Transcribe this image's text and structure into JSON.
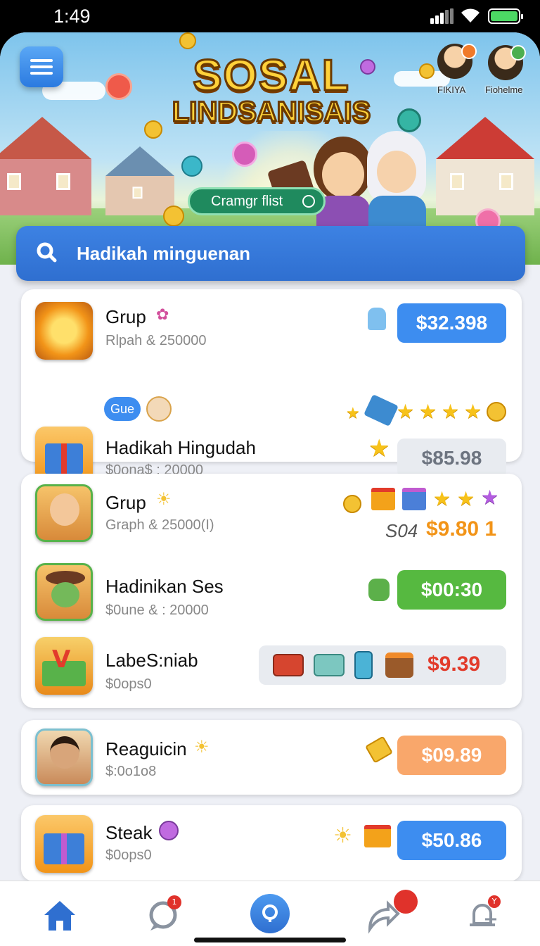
{
  "status_bar": {
    "time": "1:49"
  },
  "banner": {
    "logo_line1": "SOSAL",
    "logo_line2": "LINDSANISAIS",
    "cta_label": "Cramgr flist",
    "avatars": [
      {
        "name": "FIKIYA",
        "icon": "person-avatar"
      },
      {
        "name": "Fiohelme",
        "icon": "person-avatar"
      }
    ]
  },
  "search": {
    "placeholder": "Hadikah minguenan"
  },
  "cards": [
    {
      "rows": [
        {
          "title": "Grup",
          "subtitle": "Rlpah & 250000",
          "price": "$32.398",
          "price_color": "#3d8df0",
          "thumb_icon": "sun-icon"
        },
        {
          "tag": "Gue"
        },
        {
          "title": "Hadikah Hingudah",
          "subtitle": "$0ona$ : 20000",
          "price": "$85.98",
          "price_color": "#e8ebf0",
          "thumb_icon": "gift-icon"
        }
      ]
    },
    {
      "rows": [
        {
          "title": "Grup",
          "subtitle": "Graph & 25000(I)",
          "price_prefix": "S04",
          "price": "$9.80 1",
          "price_color": "#f29418",
          "thumb_icon": "person-icon"
        },
        {
          "title": "Hadinikan Ses",
          "subtitle": "$0une & : 20000",
          "price": "$00:30",
          "price_color": "#56b940",
          "thumb_icon": "hat-person-icon"
        },
        {
          "title": "LabeS:niab",
          "subtitle": "$0ops0",
          "price": "$9.39",
          "price_color": "#e23b2b",
          "thumb_icon": "treasure-box-icon"
        }
      ]
    },
    {
      "rows": [
        {
          "title": "Reaguicin",
          "subtitle": "$:0o1o8",
          "price": "$09.89",
          "price_color": "#f9a76b",
          "thumb_icon": "person-icon"
        }
      ]
    },
    {
      "rows": [
        {
          "title": "Steak",
          "subtitle": "$0ops0",
          "price": "$50.86",
          "price_color": "#3d8df0",
          "thumb_icon": "gift-icon"
        }
      ]
    }
  ],
  "tabbar": {
    "items": [
      {
        "icon": "home-icon",
        "badge": ""
      },
      {
        "icon": "chat-icon",
        "badge": "1"
      },
      {
        "icon": "search-icon",
        "badge": ""
      },
      {
        "icon": "share-icon",
        "badge": ""
      },
      {
        "icon": "bell-icon",
        "badge": "Y"
      }
    ]
  },
  "colors": {
    "accent": "#2f6fd0",
    "background": "#eef0f6"
  }
}
